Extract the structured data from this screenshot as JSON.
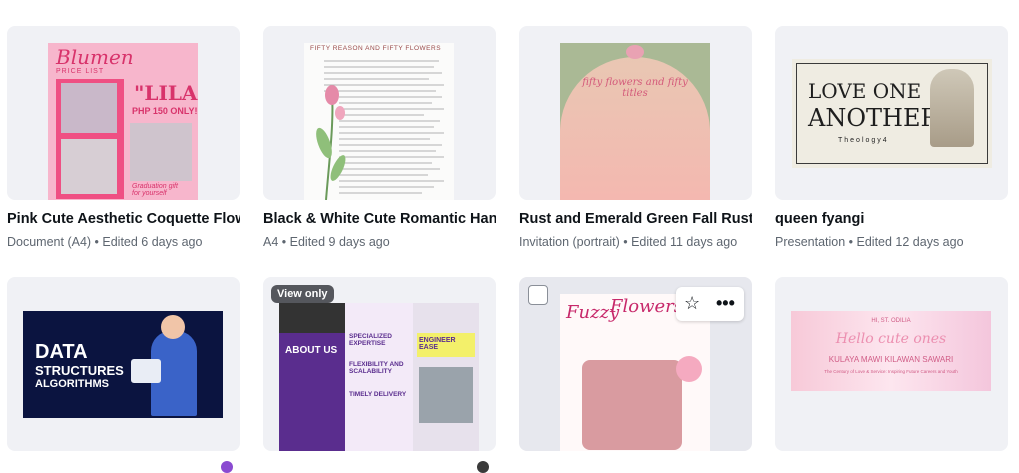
{
  "designs": [
    {
      "title": "Pink Cute Aesthetic Coquette Flower Bouquet Price List",
      "type": "Document (A4)",
      "edited": "Edited 6 days ago",
      "thumb": {
        "brand": "Blumen",
        "brand_sub": "PRICE LIST",
        "name": "\"LILA\"",
        "price": "PHP 150 ONLY!",
        "note": "Graduation gift\nfor yourself"
      }
    },
    {
      "title": "Black & White Cute Romantic Handwriting Letter",
      "type": "A4",
      "edited": "Edited 9 days ago",
      "thumb": {
        "heading": "FIFTY REASON AND FIFTY FLOWERS"
      }
    },
    {
      "title": "Rust and Emerald Green Fall Rustic Invitation",
      "type": "Invitation (portrait)",
      "edited": "Edited 11 days ago",
      "thumb": {
        "script": "fifty flowers and fifty titles"
      }
    },
    {
      "title": "queen fyangi",
      "type": "Presentation",
      "edited": "Edited 12 days ago",
      "thumb": {
        "line1": "LOVE ONE",
        "line2": "ANOTHER",
        "ref": "Theology4"
      }
    },
    {
      "badge": null,
      "thumb": {
        "line1": "DATA",
        "line2": "STRUCTURES",
        "line3": "ALGORITHMS"
      }
    },
    {
      "badge": "View only",
      "thumb": {
        "left_heading": "ABOUT US",
        "c1": "SPECIALIZED EXPERTISE",
        "c2": "FLEXIBILITY AND SCALABILITY",
        "c3": "TIMELY DELIVERY",
        "right": "ENGINEER EASE"
      }
    },
    {
      "badge": null,
      "thumb": {
        "title": "Flowers",
        "subtitle": "Fuzzy"
      }
    },
    {
      "badge": null,
      "thumb": {
        "top": "HI, ST. ODILIA",
        "script": "Hello cute ones",
        "line": "KULAYA MAWI KILAWAN SAWARI",
        "small": "The Century of Love & Service: Inspiring Future Careers and Youth"
      }
    }
  ],
  "colors": {
    "pink": "#f58fb0",
    "hotpink": "#e8467a",
    "navy": "#0b1440",
    "purple": "#5a2d8e"
  }
}
